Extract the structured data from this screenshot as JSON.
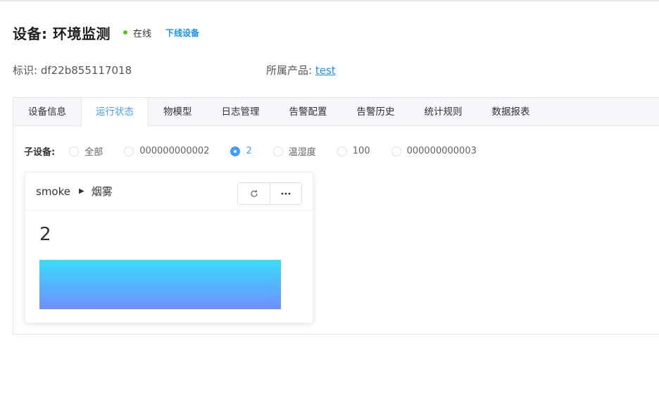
{
  "header": {
    "title": "设备: 环境监测",
    "status": "在线",
    "offline_action": "下线设备"
  },
  "meta": {
    "id_label": "标识: ",
    "id_value": "df22b855117018",
    "product_label": "所属产品: ",
    "product_value": "test"
  },
  "tabs": [
    {
      "label": "设备信息",
      "active": false
    },
    {
      "label": "运行状态",
      "active": true
    },
    {
      "label": "物模型",
      "active": false
    },
    {
      "label": "日志管理",
      "active": false
    },
    {
      "label": "告警配置",
      "active": false
    },
    {
      "label": "告警历史",
      "active": false
    },
    {
      "label": "统计规则",
      "active": false
    },
    {
      "label": "数据报表",
      "active": false
    }
  ],
  "subdevices": {
    "label": "子设备:",
    "options": [
      {
        "label": "全部",
        "checked": false
      },
      {
        "label": "000000000002",
        "checked": false
      },
      {
        "label": "2",
        "checked": true
      },
      {
        "label": "温湿度",
        "checked": false
      },
      {
        "label": "100",
        "checked": false
      },
      {
        "label": "000000000003",
        "checked": false
      }
    ]
  },
  "card": {
    "property": "smoke",
    "name": "烟雾",
    "value": "2",
    "icons": {
      "arrow": "caret-right-icon",
      "refresh": "refresh-icon",
      "more": "more-icon"
    },
    "bar_fill_fraction": 1.0
  },
  "colors": {
    "accent": "#409eff",
    "online": "#52c41a",
    "bar_gradient_top": "#3adcf8",
    "bar_gradient_bottom": "#6f8fff"
  }
}
